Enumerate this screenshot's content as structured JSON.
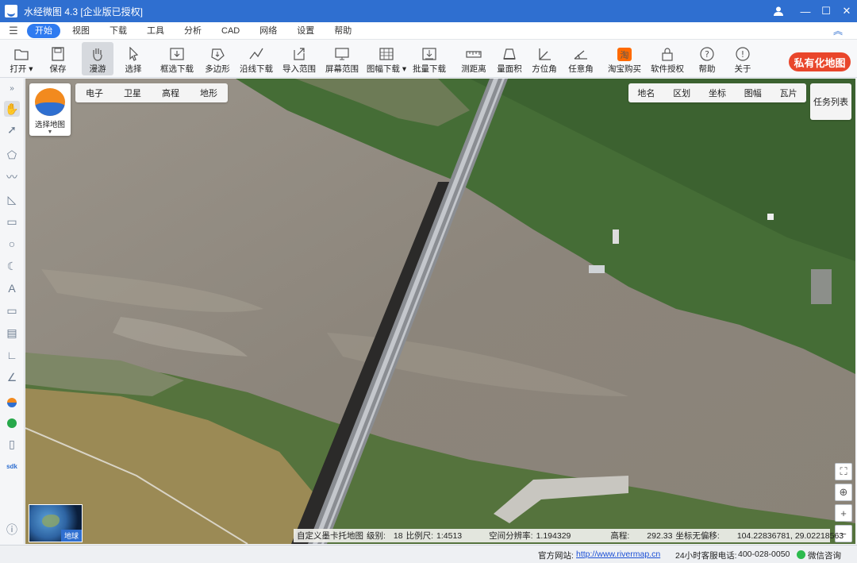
{
  "window": {
    "title": "水经微图 4.3 [企业版已授权]",
    "controls": [
      "user-icon",
      "minimize-icon",
      "maximize-icon",
      "close-icon"
    ]
  },
  "menu": {
    "items": [
      "开始",
      "视图",
      "下载",
      "工具",
      "分析",
      "CAD",
      "网络",
      "设置",
      "帮助"
    ],
    "active": "开始"
  },
  "ribbon": {
    "tools": [
      {
        "label": "打开",
        "icon": "folder-icon",
        "dropdown": true
      },
      {
        "label": "保存",
        "icon": "save-icon"
      },
      {
        "label": "漫游",
        "icon": "hand-icon",
        "active": true
      },
      {
        "label": "选择",
        "icon": "pointer-icon"
      },
      {
        "label": "框选下载",
        "icon": "box-download-icon"
      },
      {
        "label": "多边形",
        "icon": "polygon-download-icon"
      },
      {
        "label": "沿线下载",
        "icon": "line-download-icon"
      },
      {
        "label": "导入范围",
        "icon": "import-range-icon"
      },
      {
        "label": "屏幕范围",
        "icon": "screen-range-icon"
      },
      {
        "label": "图幅下载",
        "icon": "sheet-download-icon",
        "dropdown": true
      },
      {
        "label": "批量下载",
        "icon": "batch-download-icon"
      },
      {
        "label": "测距离",
        "icon": "measure-distance-icon"
      },
      {
        "label": "量面积",
        "icon": "measure-area-icon"
      },
      {
        "label": "方位角",
        "icon": "azimuth-icon"
      },
      {
        "label": "任意角",
        "icon": "any-angle-icon"
      },
      {
        "label": "淘宝购买",
        "icon": "taobao-icon"
      },
      {
        "label": "软件授权",
        "icon": "lock-icon"
      },
      {
        "label": "帮助",
        "icon": "help-icon"
      },
      {
        "label": "关于",
        "icon": "info-icon"
      }
    ],
    "private_map_label": "私有化地图",
    "taobao_glyph": "淘"
  },
  "left_tools": [
    "expand-icon",
    "hand-icon",
    "pointer-icon",
    "polygon-icon",
    "polyline-icon",
    "area-icon",
    "rectangle-icon",
    "circle-icon",
    "arc-icon",
    "text-icon",
    "ruler-icon",
    "image-icon",
    "azimuth-icon",
    "angle-icon",
    "map-logo-icon",
    "link-icon",
    "phone-icon",
    "sdk-icon",
    "help-icon"
  ],
  "map": {
    "source_label": "选择地图",
    "map_types": [
      "电子",
      "卫星",
      "高程",
      "地形"
    ],
    "overlays": [
      "地名",
      "区划",
      "坐标",
      "图幅",
      "瓦片"
    ],
    "task_list_label": "任务列表",
    "globe_label": "地球",
    "zoom_controls": [
      "fullscreen-icon",
      "locate-icon",
      "zoom-in-icon",
      "zoom-out-icon"
    ]
  },
  "status": {
    "projection": "自定义墨卡托地图",
    "level_label": "级别:",
    "level": "18",
    "scale_label": "比例尺:",
    "scale": "1:4513",
    "resolution_label": "空间分辨率:",
    "resolution": "1.194329",
    "elevation_label": "高程:",
    "elevation": "292.33",
    "coord_label": "坐标无偏移:",
    "coords": "104.22836781, 29.02218563"
  },
  "footer": {
    "website_label": "官方网站:",
    "website": "http://www.rivermap.cn",
    "hotline_label": "24小时客服电话:",
    "hotline": "400-028-0050",
    "wechat_label": "微信咨询"
  },
  "colors": {
    "titlebar": "#2f6fd0",
    "accent": "#2f7bf0",
    "private_map": "#e9462b",
    "river": "#8e8980",
    "vegetation": "#3f6b33"
  }
}
